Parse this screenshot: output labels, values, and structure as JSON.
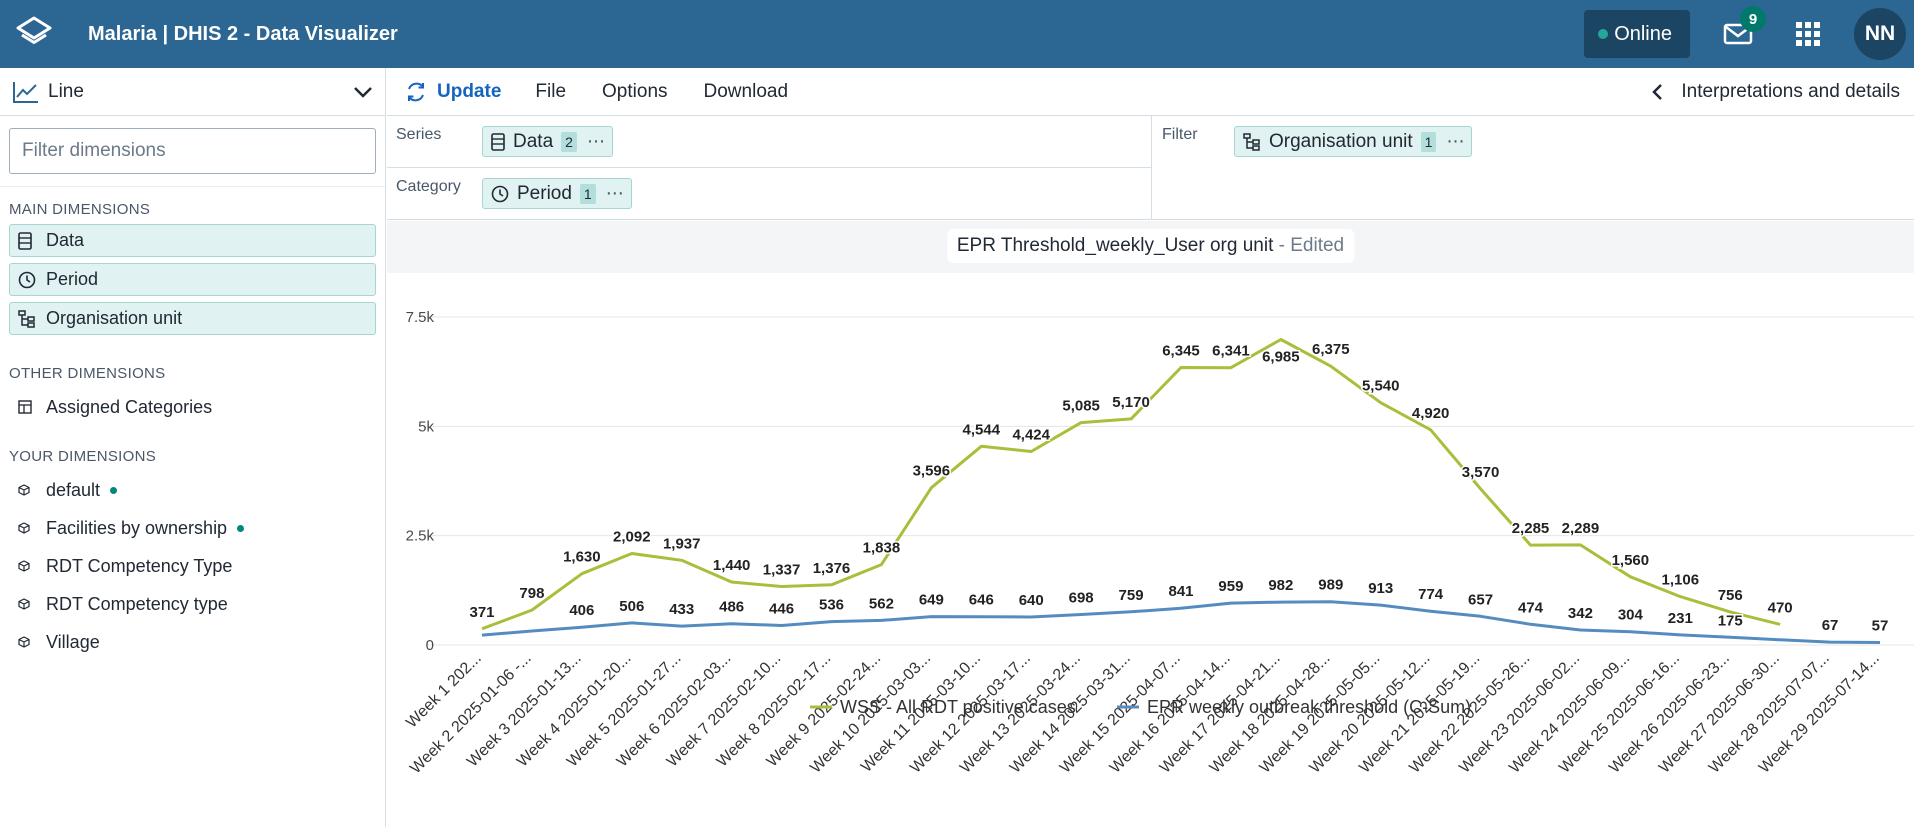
{
  "header": {
    "title": "Malaria | DHIS 2 - Data Visualizer",
    "online_label": "Online",
    "mail_count": "9",
    "avatar_initials": "NN"
  },
  "sidebar": {
    "vis_type": "Line",
    "filter_placeholder": "Filter dimensions",
    "main_title": "MAIN DIMENSIONS",
    "main_items": [
      {
        "label": "Data",
        "icon": "data-icon"
      },
      {
        "label": "Period",
        "icon": "clock-icon"
      },
      {
        "label": "Organisation unit",
        "icon": "org-tree-icon"
      }
    ],
    "other_title": "OTHER DIMENSIONS",
    "other_items": [
      {
        "label": "Assigned Categories",
        "icon": "grid-icon"
      }
    ],
    "your_title": "YOUR DIMENSIONS",
    "your_items": [
      {
        "label": "default",
        "icon": "cube-icon",
        "dot": true
      },
      {
        "label": "Facilities by ownership",
        "icon": "cube-icon",
        "dot": true
      },
      {
        "label": "RDT Competency Type",
        "icon": "cube-icon",
        "dot": false
      },
      {
        "label": "RDT Competency type",
        "icon": "cube-icon",
        "dot": false
      },
      {
        "label": "Village",
        "icon": "cube-icon",
        "dot": false
      }
    ]
  },
  "menubar": {
    "update": "Update",
    "file": "File",
    "options": "Options",
    "download": "Download",
    "interpretations": "Interpretations and details"
  },
  "layout": {
    "series_label": "Series",
    "series_chip": {
      "label": "Data",
      "count": "2"
    },
    "category_label": "Category",
    "category_chip": {
      "label": "Period",
      "count": "1"
    },
    "filter_label": "Filter",
    "filter_chip": {
      "label": "Organisation unit",
      "count": "1"
    }
  },
  "chart_title": "EPR Threshold_weekly_User org unit",
  "chart_title_suffix": " - Edited",
  "colors": {
    "header": "#2c6693",
    "series1": "#a9be3b",
    "series2": "#558cc0"
  },
  "chart_data": {
    "type": "line",
    "categories": [
      "Week 1 202...",
      "Week 2 2025-01-06 -...",
      "Week 3 2025-01-13...",
      "Week 4 2025-01-20...",
      "Week 5 2025-01-27...",
      "Week 6 2025-02-03...",
      "Week 7 2025-02-10...",
      "Week 8 2025-02-17...",
      "Week 9 2025-02-24...",
      "Week 10 2025-03-03...",
      "Week 11 2025-03-10...",
      "Week 12 2025-03-17...",
      "Week 13 2025-03-24...",
      "Week 14 2025-03-31...",
      "Week 15 2025-04-07...",
      "Week 16 2025-04-14...",
      "Week 17 2025-04-21...",
      "Week 18 2025-04-28...",
      "Week 19 2025-05-05...",
      "Week 20 2025-05-12...",
      "Week 21 2025-05-19...",
      "Week 22 2025-05-26...",
      "Week 23 2025-06-02...",
      "Week 24 2025-06-09...",
      "Week 25 2025-06-16...",
      "Week 26 2025-06-23...",
      "Week 27 2025-06-30...",
      "Week 28 2025-07-07...",
      "Week 29 2025-07-14..."
    ],
    "series": [
      {
        "name": "WSS - All RDT positive cases",
        "color": "#a9be3b",
        "values": [
          371,
          798,
          1630,
          2092,
          1937,
          1440,
          1337,
          1376,
          1838,
          3596,
          4544,
          4424,
          5085,
          5170,
          6345,
          6341,
          6985,
          6375,
          5540,
          4920,
          3570,
          2285,
          2289,
          1560,
          1106,
          756,
          470,
          null,
          null
        ],
        "labels": [
          "371",
          "798",
          "1,630",
          "2,092",
          "1,937",
          "1,440",
          "1,337",
          "1,376",
          "1,838",
          "3,596",
          "4,544",
          "4,424",
          "5,085",
          "5,170",
          "6,345",
          "6,341",
          "6,985",
          "6,375",
          "5,540",
          "4,920",
          "3,570",
          "2,285",
          "2,289",
          "1,560",
          "1,106",
          "756",
          "470",
          "",
          ""
        ]
      },
      {
        "name": "EPR weekly outbreak threshold (C-Sum)",
        "color": "#558cc0",
        "values": [
          226,
          320,
          406,
          506,
          433,
          486,
          446,
          536,
          562,
          649,
          646,
          640,
          698,
          759,
          841,
          959,
          982,
          989,
          913,
          774,
          657,
          474,
          342,
          304,
          231,
          175,
          120,
          67,
          57
        ],
        "labels": [
          "",
          "",
          "406",
          "506",
          "433",
          "486",
          "446",
          "536",
          "562",
          "649",
          "646",
          "640",
          "698",
          "759",
          "841",
          "959",
          "982",
          "989",
          "913",
          "774",
          "657",
          "474",
          "342",
          "304",
          "231",
          "175",
          "",
          "67",
          "57"
        ]
      }
    ],
    "yticks": [
      "0",
      "2.5k",
      "5k",
      "7.5k"
    ],
    "ylim": [
      0,
      7500
    ],
    "legend_position": "bottom",
    "grid": true
  }
}
